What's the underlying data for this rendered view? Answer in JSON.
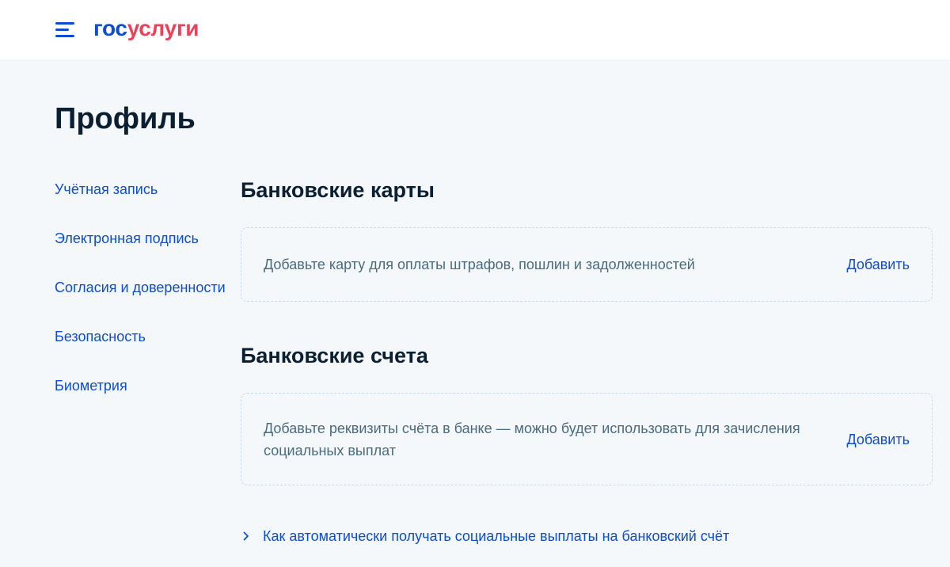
{
  "header": {
    "logo": {
      "part1": "гос",
      "part2": "услуги"
    },
    "menu_icon": "burger-menu-icon"
  },
  "page": {
    "title": "Профиль"
  },
  "sidebar": {
    "items": [
      {
        "label": "Учётная запись"
      },
      {
        "label": "Электронная подпись"
      },
      {
        "label": "Согласия и доверенности"
      },
      {
        "label": "Безопасность"
      },
      {
        "label": "Биометрия"
      }
    ]
  },
  "bank_cards": {
    "title": "Банковские карты",
    "description": "Добавьте карту для оплаты штрафов, пошлин и задолженностей",
    "action": "Добавить"
  },
  "bank_accounts": {
    "title": "Банковские счета",
    "description": "Добавьте реквизиты счёта в банке — можно будет использовать для зачисления социальных выплат",
    "action": "Добавить"
  },
  "info_link": {
    "label": "Как автоматически получать социальные выплаты на банковский счёт",
    "icon": "chevron-right-icon"
  },
  "colors": {
    "accent": "#0d4cd3",
    "logo_red": "#ee3f58",
    "background": "#f5f8fb",
    "text_dark": "#0b1f33",
    "text_muted": "#4a6b7c",
    "card_border": "#c9d9e8"
  }
}
